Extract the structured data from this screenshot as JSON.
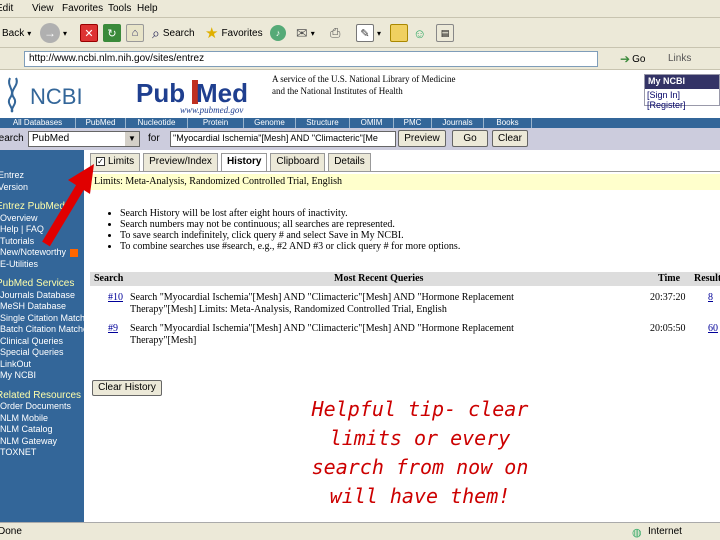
{
  "menu": [
    "Edit",
    "View",
    "Favorites",
    "Tools",
    "Help"
  ],
  "toolbar": {
    "back_label": "Back",
    "search_label": "Search",
    "favorites_label": "Favorites"
  },
  "address": {
    "url": "http://www.ncbi.nlm.nih.gov/sites/entrez",
    "go_label": "Go",
    "links_label": "Links"
  },
  "header": {
    "ncbi_text": "NCBI",
    "pubmed_pub": "Pub",
    "pubmed_med": "Med",
    "pubmed_url": "www.pubmed.gov",
    "nlm_line1": "A service of the U.S. National Library of Medicine",
    "nlm_line2": "and the National Institutes of Health",
    "myncbi_title": "My NCBI",
    "myncbi_sub": "[Sign In] [Register]"
  },
  "navbar": [
    "All Databases",
    "PubMed",
    "Nucleotide",
    "Protein",
    "Genome",
    "Structure",
    "OMIM",
    "PMC",
    "Journals",
    "Books"
  ],
  "search": {
    "search_label": "Search",
    "db_value": "PubMed",
    "for_label": "for",
    "query": "\"Myocardial Ischemia\"[Mesh] AND \"Climacteric\"[Me",
    "preview_label": "Preview",
    "go_label": "Go",
    "clear_label": "Clear"
  },
  "sidebar": {
    "top": [
      "Entrez",
      "Version"
    ],
    "pubmed_header": "Entrez PubMed",
    "pubmed_items": [
      "Overview",
      "Help | FAQ",
      "Tutorials",
      "New/Noteworthy",
      "E-Utilities"
    ],
    "services_header": "PubMed Services",
    "services_items": [
      "Journals Database",
      "MeSH Database",
      "Single Citation Matcher",
      "Batch Citation Matcher",
      "Clinical Queries",
      "Special Queries",
      "LinkOut",
      "My NCBI"
    ],
    "related_header": "Related Resources",
    "related_items": [
      "Order Documents",
      "NLM Mobile",
      "NLM Catalog",
      "NLM Gateway",
      "TOXNET"
    ]
  },
  "tabs": [
    "Limits",
    "Preview/Index",
    "History",
    "Clipboard",
    "Details"
  ],
  "limits_bar": "Limits: Meta-Analysis, Randomized Controlled Trial, English",
  "notes": [
    "Search History will be lost after eight hours of inactivity.",
    "Search numbers may not be continuous; all searches are represented.",
    "To save search indefinitely, click query # and select Save in My NCBI.",
    "To combine searches use #search, e.g., #2 AND #3 or click query # for more options."
  ],
  "history": {
    "col_search": "Search",
    "col_query": "Most Recent Queries",
    "col_time": "Time",
    "col_result": "Result",
    "rows": [
      {
        "num": "#10",
        "line1": "Search \"Myocardial Ischemia\"[Mesh] AND \"Climacteric\"[Mesh] AND \"Hormone Replacement",
        "line2": "Therapy\"[Mesh] Limits: Meta-Analysis, Randomized Controlled Trial, English",
        "time": "20:37:20",
        "result": "8"
      },
      {
        "num": "#9",
        "line1": "Search \"Myocardial Ischemia\"[Mesh] AND \"Climacteric\"[Mesh] AND \"Hormone Replacement",
        "line2": "Therapy\"[Mesh]",
        "time": "20:05:50",
        "result": "60"
      }
    ],
    "clear_label": "Clear History"
  },
  "tip": "Helpful tip- clear limits or every search from now on will have them!",
  "status": {
    "left": "Done",
    "zone": "Internet"
  },
  "colors": {
    "ncbi_blue": "#336699",
    "tip_red": "#cc0000",
    "arrow_red": "#e00000",
    "limits_yellow": "#ffffcc"
  }
}
